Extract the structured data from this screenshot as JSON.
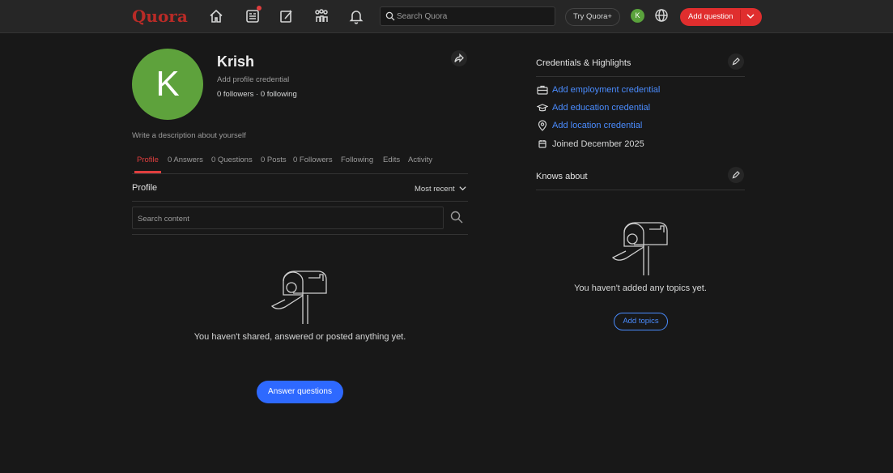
{
  "header": {
    "logo": "Quora",
    "search_placeholder": "Search Quora",
    "try_plus": "Try Quora+",
    "avatar_initial": "K",
    "add_question": "Add question",
    "nav_icons": [
      "home-icon",
      "following-icon",
      "answer-icon",
      "spaces-icon",
      "notifications-icon"
    ],
    "brand_color": "#b92b27",
    "accent_red": "#e02e2e"
  },
  "profile": {
    "avatar_initial": "K",
    "name": "Krish",
    "credential_prompt": "Add profile credential",
    "follow_stats": "0 followers · 0 following",
    "description_prompt": "Write a description about yourself",
    "avatar_color": "#5ea23c"
  },
  "tabs": [
    {
      "label": "Profile"
    },
    {
      "label": "0 Answers"
    },
    {
      "label": "0 Questions"
    },
    {
      "label": "0 Posts"
    },
    {
      "label": "0 Followers"
    },
    {
      "label": "Following"
    },
    {
      "label": "Edits"
    },
    {
      "label": "Activity"
    }
  ],
  "content": {
    "section_title": "Profile",
    "sort_label": "Most recent",
    "search_placeholder": "Search content",
    "empty_message": "You haven't shared, answered or posted anything yet.",
    "answer_button": "Answer questions"
  },
  "sidebar": {
    "credentials_title": "Credentials & Highlights",
    "credentials": [
      {
        "label": "Add employment credential",
        "icon": "briefcase-icon"
      },
      {
        "label": "Add education credential",
        "icon": "graduation-cap-icon"
      },
      {
        "label": "Add location credential",
        "icon": "location-pin-icon"
      },
      {
        "label": "Joined December 2025",
        "icon": "calendar-icon"
      }
    ],
    "knows_title": "Knows about",
    "knows_empty": "You haven't added any topics yet.",
    "add_topics": "Add topics",
    "link_color": "#4a8cff"
  }
}
